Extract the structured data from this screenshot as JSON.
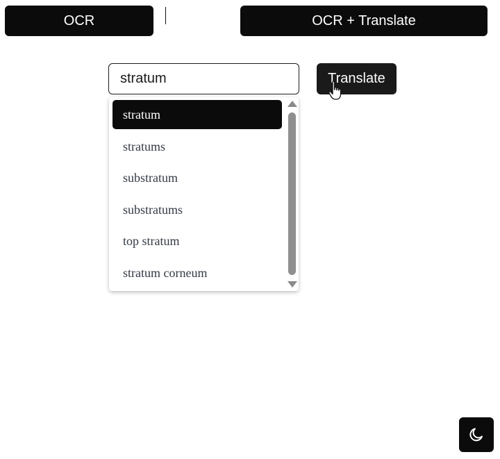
{
  "toolbar": {
    "ocr_label": "OCR",
    "ocr_translate_label": "OCR + Translate"
  },
  "search": {
    "value": "stratum",
    "placeholder": ""
  },
  "translate_button": {
    "label": "Translate"
  },
  "suggestions": [
    {
      "label": "stratum",
      "selected": true
    },
    {
      "label": "stratums",
      "selected": false
    },
    {
      "label": "substratum",
      "selected": false
    },
    {
      "label": "substratums",
      "selected": false
    },
    {
      "label": "top stratum",
      "selected": false
    },
    {
      "label": "stratum corneum",
      "selected": false
    }
  ],
  "theme_toggle": {
    "icon": "moon-icon"
  },
  "colors": {
    "button_bg": "#0b0b0c",
    "button_text": "#ffffff",
    "suggestion_text": "#333a45",
    "scrollbar": "#8f8f8f"
  }
}
